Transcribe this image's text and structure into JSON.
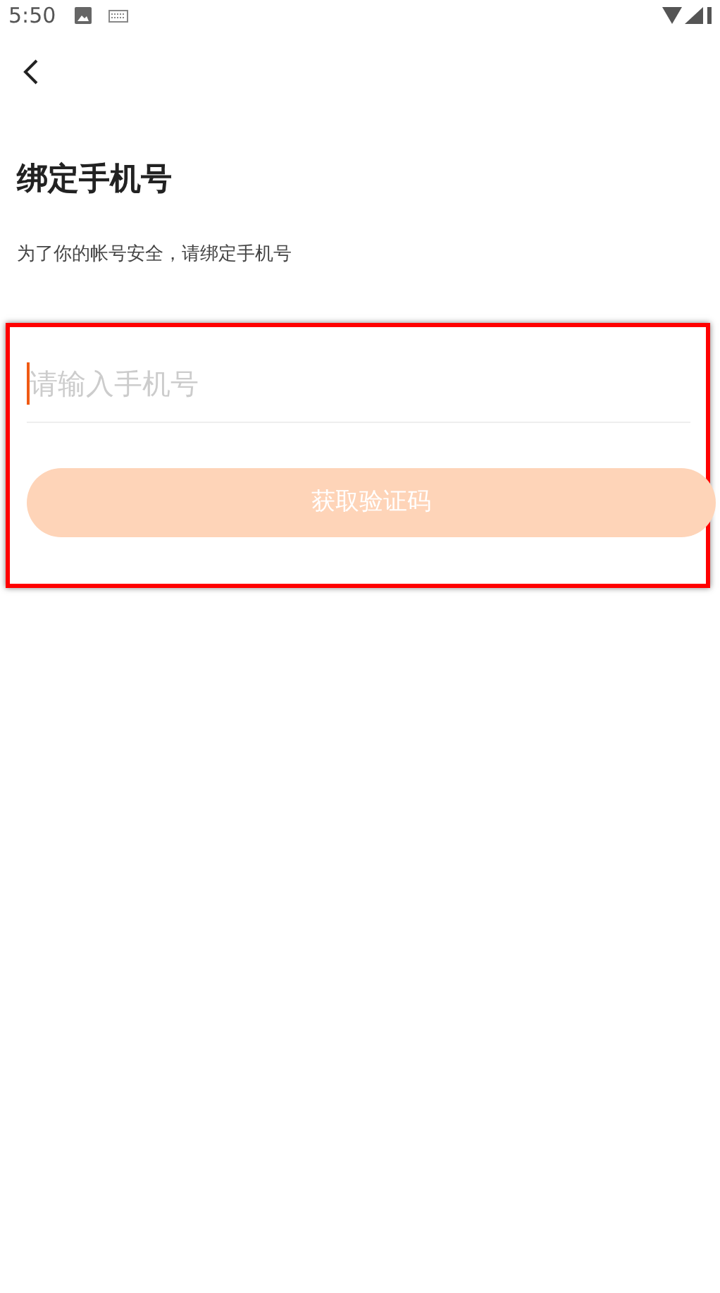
{
  "status_bar": {
    "time": "5:50"
  },
  "title": "绑定手机号",
  "subtitle": "为了你的帐号安全，请绑定手机号",
  "highlighted": true,
  "phone_field": {
    "placeholder": "请输入手机号",
    "focused": true
  },
  "button": {
    "label": "获取验证码",
    "disabled": true
  }
}
